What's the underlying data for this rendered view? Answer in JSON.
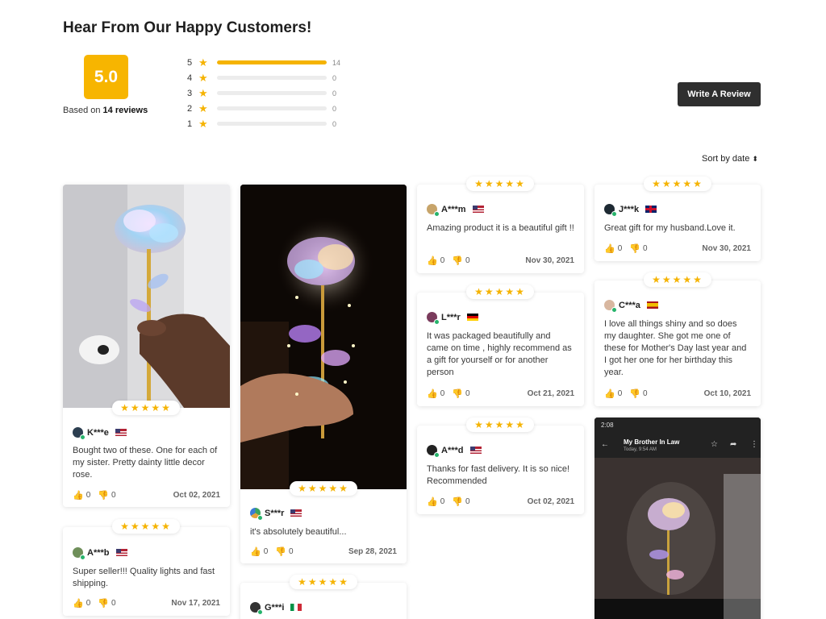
{
  "header": {
    "title": "Hear From Our Happy Customers!",
    "score": "5.0",
    "based_prefix": "Based on",
    "based_count": "14 reviews",
    "write_button": "Write A Review",
    "sort_label": "Sort by date"
  },
  "distribution": [
    {
      "stars": "5",
      "count": "14",
      "fraction": 1.0
    },
    {
      "stars": "4",
      "count": "0",
      "fraction": 0
    },
    {
      "stars": "3",
      "count": "0",
      "fraction": 0
    },
    {
      "stars": "2",
      "count": "0",
      "fraction": 0
    },
    {
      "stars": "1",
      "count": "0",
      "fraction": 0
    }
  ],
  "colors": {
    "accent": "#f7b500",
    "button": "#2f2f2f",
    "verified": "#26b36b"
  },
  "stars": "★★★★★",
  "reviews": [
    {
      "author": "K***e",
      "country": "US",
      "text": "Bought two of these. One for each of my sister. Pretty dainty little decor rose.",
      "likes": "0",
      "dislikes": "0",
      "date": "Oct 02, 2021"
    },
    {
      "author": "A***b",
      "country": "US",
      "text": "Super seller!!! Quality lights and fast shipping.",
      "likes": "0",
      "dislikes": "0",
      "date": "Nov 17, 2021"
    },
    {
      "author": "S***r",
      "country": "US",
      "text": "it's absolutely beautiful...",
      "likes": "0",
      "dislikes": "0",
      "date": "Sep 28, 2021"
    },
    {
      "author": "G***i",
      "country": "IT"
    },
    {
      "author": "A***m",
      "country": "US",
      "text": "Amazing product it is a beautiful gift !!",
      "likes": "0",
      "dislikes": "0",
      "date": "Nov 30, 2021"
    },
    {
      "author": "L***r",
      "country": "DE",
      "text": "It was packaged beautifully and came on time , highly recommend as a gift for yourself or for another person",
      "likes": "0",
      "dislikes": "0",
      "date": "Oct 21, 2021"
    },
    {
      "author": "A***d",
      "country": "US",
      "text": "Thanks for fast delivery. It is so nice! Recommended",
      "likes": "0",
      "dislikes": "0",
      "date": "Oct 02, 2021"
    },
    {
      "author": "J***k",
      "country": "GB",
      "text": "Great gift for my husband.Love it.",
      "likes": "0",
      "dislikes": "0",
      "date": "Nov 30, 2021"
    },
    {
      "author": "C***a",
      "country": "ES",
      "text": "I love all things shiny and so does my daughter. She got me one of these for Mother's Day last year and I got her one for her birthday this year.",
      "likes": "0",
      "dislikes": "0",
      "date": "Oct 10, 2021"
    }
  ],
  "phone_screenshot": {
    "time": "2:08",
    "chat_title": "My Brother In Law",
    "chat_subtitle": "Today, 9:54 AM"
  }
}
